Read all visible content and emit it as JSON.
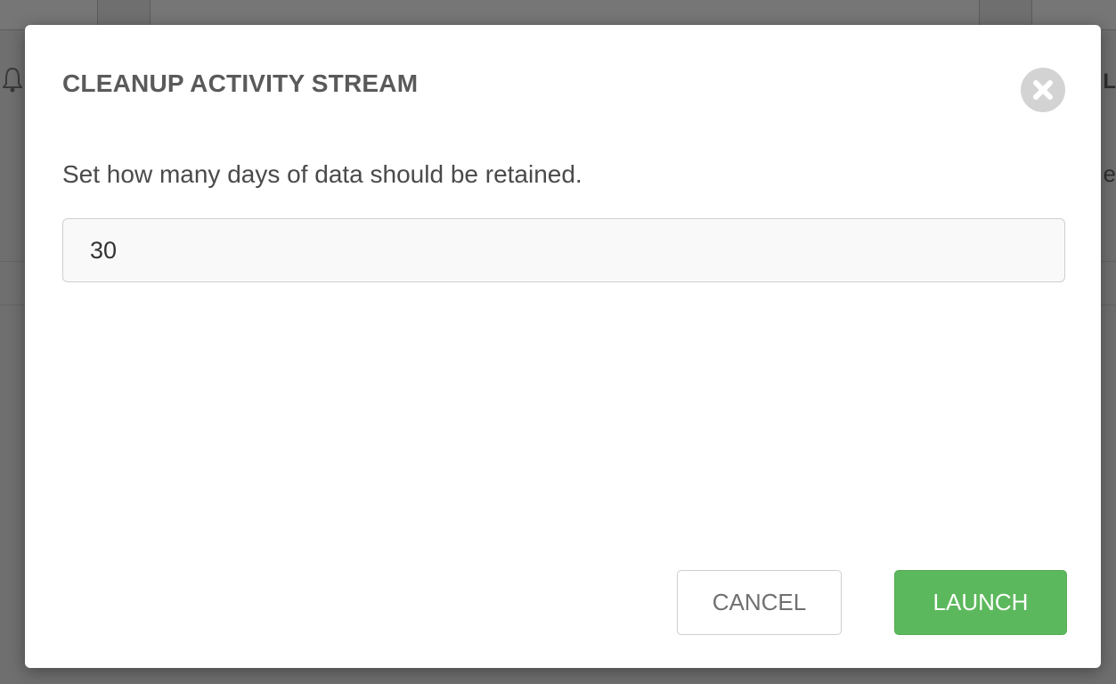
{
  "modal": {
    "title": "CLEANUP ACTIVITY STREAM",
    "prompt": "Set how many days of data should be retained.",
    "days_value": "30",
    "cancel_label": "CANCEL",
    "launch_label": "LAUNCH",
    "close_icon": "close-circle-icon"
  },
  "background": {
    "right_text_1": "L",
    "right_text_2": "e"
  },
  "colors": {
    "overlay": "#6f6f6f",
    "title": "#5a5a5a",
    "launch": "#5cb85c",
    "close": "#d3d3d3"
  }
}
